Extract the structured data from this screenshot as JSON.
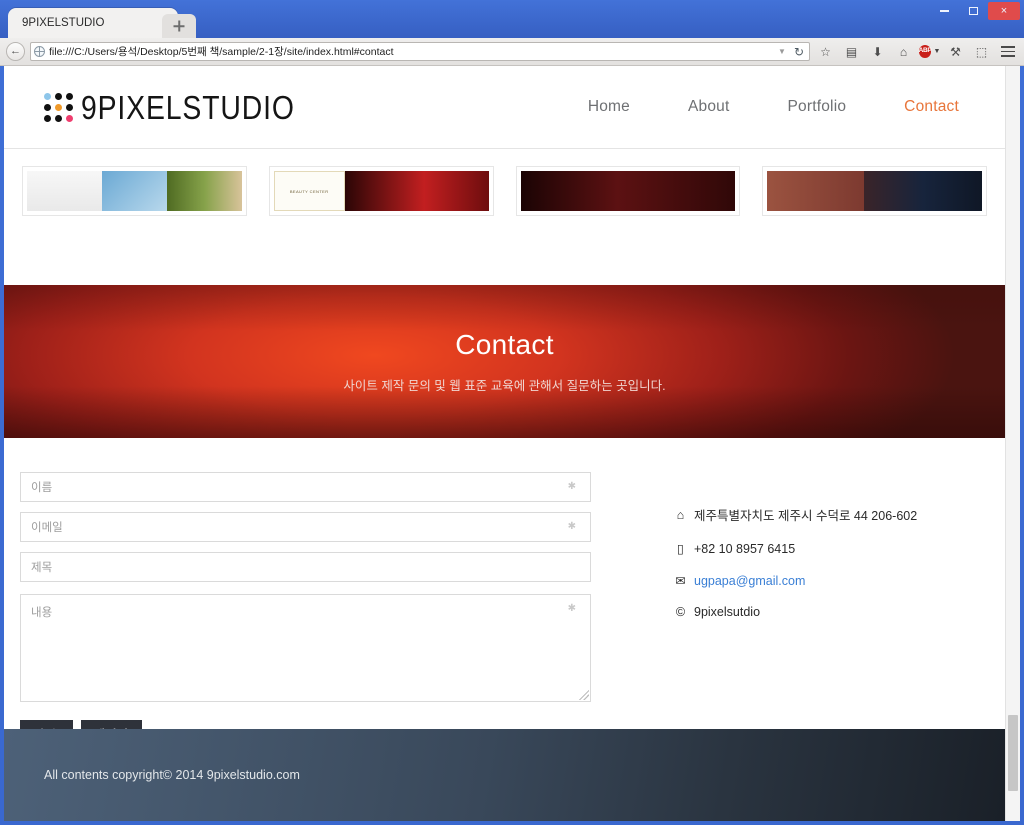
{
  "browser": {
    "tab_title": "9PIXELSTUDIO",
    "new_tab_label": "+",
    "window_buttons": {
      "minimize": "minimize-icon",
      "maximize": "maximize-icon",
      "close": "×"
    },
    "back_glyph": "←",
    "url": "file:///C:/Users/용석/Desktop/5번째 책/sample/2-1장/site/index.html#contact",
    "url_dropdown_glyph": "▼",
    "reload_glyph": "↻",
    "toolbar_icons": [
      {
        "name": "bookmark-star-icon",
        "glyph": "☆"
      },
      {
        "name": "reading-list-icon",
        "glyph": "▤"
      },
      {
        "name": "download-icon",
        "glyph": "⬇"
      },
      {
        "name": "home-icon",
        "glyph": "⌂"
      },
      {
        "name": "adblock-plus-icon",
        "glyph": "ABP"
      },
      {
        "name": "wrench-icon",
        "glyph": "⚒"
      },
      {
        "name": "extensions-icon",
        "glyph": "⬚"
      },
      {
        "name": "menu-icon",
        "glyph": "☰"
      }
    ]
  },
  "site": {
    "logo_text": "9PIXELSTUDIO",
    "nav": [
      {
        "label": "Home",
        "active": false
      },
      {
        "label": "About",
        "active": false
      },
      {
        "label": "Portfolio",
        "active": false
      },
      {
        "label": "Contact",
        "active": true
      }
    ],
    "accent_color": "#e8753a"
  },
  "portfolio_strip": {
    "card2_caption": "BEAUTY CENTER"
  },
  "hero": {
    "title": "Contact",
    "subtitle": "사이트 제작 문의 및 웹 표준 교육에 관해서 질문하는 곳입니다.",
    "background_color": "#c2301d"
  },
  "form": {
    "fields": [
      {
        "name": "name-field",
        "placeholder": "이름",
        "value": "",
        "required_mark": "✱"
      },
      {
        "name": "email-field",
        "placeholder": "이메일",
        "value": "",
        "required_mark": "✱"
      },
      {
        "name": "subject-field",
        "placeholder": "제목",
        "value": "",
        "required_mark": ""
      }
    ],
    "message": {
      "placeholder": "내용",
      "value": "",
      "required_mark": "✱"
    },
    "submit_label": "전 송",
    "reset_label": "재설정",
    "button_color": "#2e323a"
  },
  "contact_info": [
    {
      "icon": "home-icon",
      "glyph": "⌂",
      "text": "제주특별자치도 제주시 수덕로 44 206-602",
      "link": false
    },
    {
      "icon": "mobile-phone-icon",
      "glyph": "▯",
      "text": "+82 10 8957 6415",
      "link": false
    },
    {
      "icon": "envelope-icon",
      "glyph": "✉",
      "text": "ugpapa@gmail.com",
      "link": true
    },
    {
      "icon": "copyright-icon",
      "glyph": "©",
      "text": "9pixelsutdio",
      "link": false
    }
  ],
  "footer": {
    "copyright": "All contents copyright© 2014 9pixelstudio.com"
  }
}
